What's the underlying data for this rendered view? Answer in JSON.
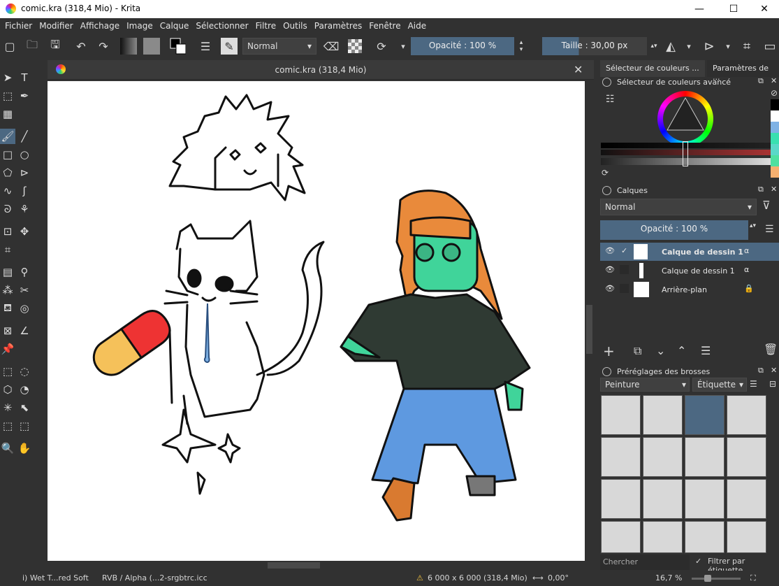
{
  "window": {
    "title": "comic.kra (318,4 Mio)  - Krita",
    "minimize": "—",
    "maximize": "☐",
    "close": "✕"
  },
  "menu": [
    "Fichier",
    "Modifier",
    "Affichage",
    "Image",
    "Calque",
    "Sélectionner",
    "Filtre",
    "Outils",
    "Paramètres",
    "Fenêtre",
    "Aide"
  ],
  "toolbar": {
    "blend_mode": "Normal",
    "opacity": "Opacité : 100 %",
    "size": "Taille :  30,00 px"
  },
  "document": {
    "tab_title": "comic.kra (318,4 Mio)",
    "close": "✕"
  },
  "right": {
    "tab1": "Sélecteur de couleurs ...",
    "tab2": "Paramètres de ...",
    "color_dock_title": "Sélecteur de couleurs avancé",
    "layers_title": "Calques",
    "layers_blend": "Normal",
    "layers_opacity": "Opacité : 100 %",
    "layers": [
      {
        "name": "Calque de dessin 1",
        "selected": true
      },
      {
        "name": "Calque de dessin 1",
        "selected": false
      },
      {
        "name": "Arrière-plan",
        "selected": false
      }
    ],
    "brush_title": "Préréglages des brosses",
    "brush_category": "Peinture",
    "brush_tag": "Étiquette",
    "search_placeholder": "Chercher",
    "filter_label": "Filtrer par étiquette"
  },
  "status": {
    "brush": "i) Wet T...red Soft",
    "colorspace": "RVB / Alpha (...2-srgbtrc.icc",
    "dimensions": "6 000 x 6 000 (318,4 Mio)",
    "rotation": "0,00°",
    "zoom": "16,7 %"
  },
  "colors": {
    "accent": "#4c6882",
    "panel": "#313131",
    "swatches": [
      "#ffffff",
      "#7fb2e5",
      "#39e0b0",
      "#5ad8c8",
      "#4fe0a0",
      "#f5b070"
    ]
  }
}
